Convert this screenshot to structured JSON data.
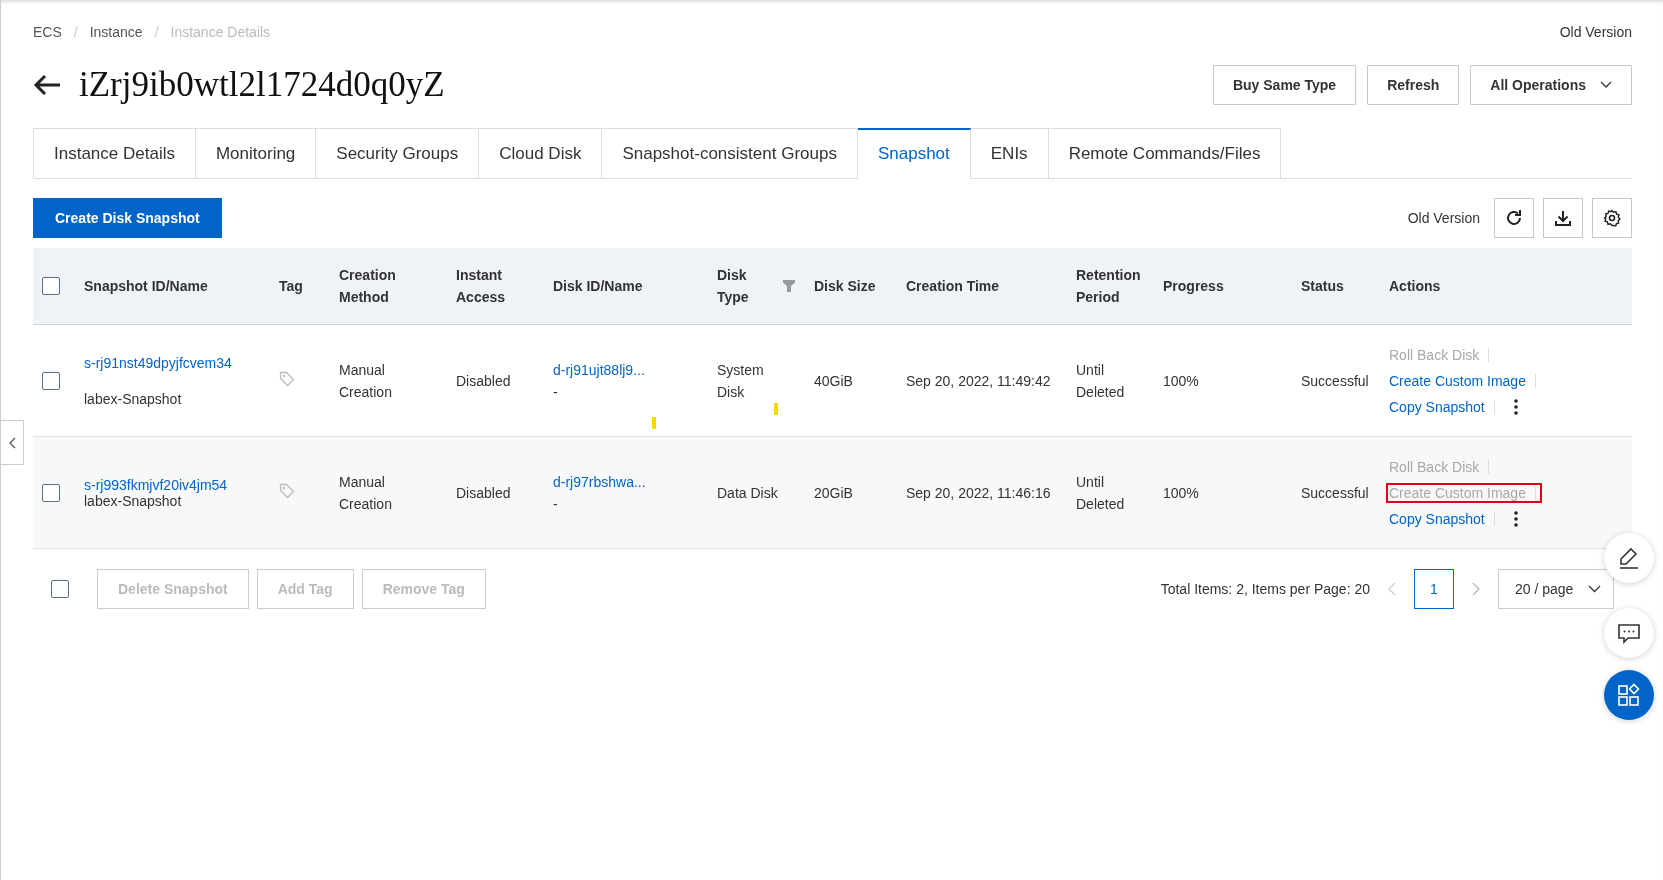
{
  "breadcrumb": [
    {
      "label": "ECS",
      "current": false
    },
    {
      "separator": "/",
      "label": "Instance",
      "current": false
    },
    {
      "separator": "/",
      "label": "Instance Details",
      "current": true
    }
  ],
  "version_link": "Old Version",
  "title": "iZrj9ib0wtl2l1724d0q0yZ",
  "header_buttons": [
    {
      "label": "Buy Same Type",
      "dropdown": false
    },
    {
      "label": "Refresh",
      "dropdown": false
    },
    {
      "label": "All Operations",
      "dropdown": true
    }
  ],
  "tabs": [
    {
      "label": "Instance Details",
      "selected": false
    },
    {
      "label": "Monitoring",
      "selected": false
    },
    {
      "label": "Security Groups",
      "selected": false
    },
    {
      "label": "Cloud Disk",
      "selected": false
    },
    {
      "label": "Snapshot-consistent Groups",
      "selected": false
    },
    {
      "label": "Snapshot",
      "selected": true
    },
    {
      "label": "ENIs",
      "selected": false
    },
    {
      "label": "Remote Commands/Files",
      "selected": false
    }
  ],
  "toolbar": {
    "primary_button": "Create Disk Snapshot",
    "version_link": "Old Version"
  },
  "table": {
    "header_checked": false,
    "columns": [
      {
        "label": "Snapshot ID/Name",
        "filter": false
      },
      {
        "label": "Tag",
        "filter": false
      },
      {
        "label": "Creation Method",
        "filter": false
      },
      {
        "label": "Instant Access",
        "filter": false
      },
      {
        "label": "Disk ID/Name",
        "filter": false
      },
      {
        "label": "Disk Type",
        "filter": true
      },
      {
        "label": "Disk Size",
        "filter": false
      },
      {
        "label": "Creation Time",
        "filter": false
      },
      {
        "label": "Retention Period",
        "filter": false
      },
      {
        "label": "Progress",
        "filter": false
      },
      {
        "label": "Status",
        "filter": false
      },
      {
        "label": "Actions",
        "filter": false
      }
    ],
    "rows": [
      {
        "checked": false,
        "hovered": false,
        "snapshot_id": "s-rj91nst49dpyjfcvem34",
        "snapshot_name": "labex-Snapshot",
        "creation_method": "Manual Creation",
        "instant_access": "Disabled",
        "disk_id": "d-rj91ujt88lj9...",
        "disk_name": "-",
        "disk_type": "System Disk",
        "disk_size": "40GiB",
        "creation_time": "Sep 20, 2022, 11:49:42",
        "retention_period": "Until Deleted",
        "progress": "100%",
        "status": "Successful",
        "marks": true,
        "actions": [
          {
            "label": "Roll Back Disk",
            "disabled": true,
            "highlighted": false
          },
          {
            "label": "Create Custom Image",
            "disabled": false,
            "highlighted": false
          },
          {
            "label": "Copy Snapshot",
            "disabled": false,
            "highlighted": false
          }
        ]
      },
      {
        "checked": false,
        "hovered": true,
        "snapshot_id": "s-rj993fkmjvf20iv4jm54",
        "snapshot_name": "labex-Snapshot",
        "creation_method": "Manual Creation",
        "instant_access": "Disabled",
        "disk_id": "d-rj97rbshwa...",
        "disk_name": "-",
        "disk_type": "Data Disk",
        "disk_size": "20GiB",
        "creation_time": "Sep 20, 2022, 11:46:16",
        "retention_period": "Until Deleted",
        "progress": "100%",
        "status": "Successful",
        "marks": false,
        "actions": [
          {
            "label": "Roll Back Disk",
            "disabled": true,
            "highlighted": false
          },
          {
            "label": "Create Custom Image",
            "disabled": true,
            "highlighted": true
          },
          {
            "label": "Copy Snapshot",
            "disabled": false,
            "highlighted": false
          }
        ]
      }
    ]
  },
  "footer": {
    "select_all_checked": false,
    "bulk_buttons": [
      {
        "label": "Delete Snapshot",
        "disabled": true
      },
      {
        "label": "Add Tag",
        "disabled": true
      },
      {
        "label": "Remove Tag",
        "disabled": true
      }
    ],
    "total_text": "Total Items: 2, Items per Page: 20",
    "pages": [
      {
        "label": "1",
        "selected": true
      }
    ],
    "page_size": "20 / page"
  }
}
